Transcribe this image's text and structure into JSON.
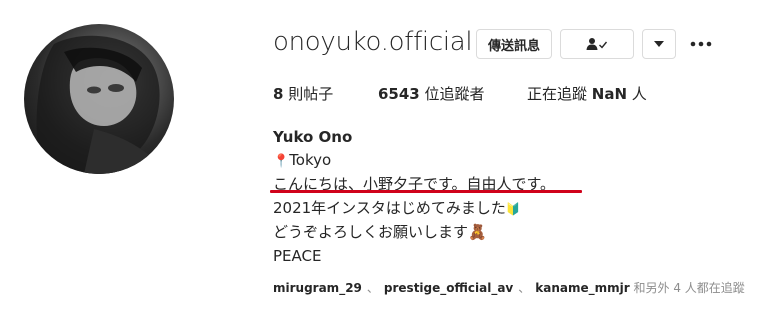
{
  "profile": {
    "username": "onoyuko.official",
    "display_name": "Yuko Ono"
  },
  "actions": {
    "message_label": "傳送訊息",
    "follow_icon": "person-check-icon",
    "dropdown_icon": "caret-down-icon",
    "more_icon": "more-horizontal-icon"
  },
  "stats": {
    "posts_count": "8",
    "posts_label": " 則帖子",
    "followers_count": "6543",
    "followers_label": " 位追蹤者",
    "following_prefix": "正在追蹤 ",
    "following_count": "NaN",
    "following_label": " 人"
  },
  "bio": {
    "location_icon": "📍",
    "location_text": "Tokyo",
    "line2": "こんにちは、小野夕子です。自由人です。",
    "line3": "2021年インスタはじめてみました",
    "line3_emoji": "🔰",
    "line4": "どうぞよろしくお願いします",
    "line4_emoji": "🧸",
    "line5": "PEACE"
  },
  "followed_by": {
    "accounts": [
      "mirugram_29",
      "prestige_official_av",
      "kaname_mmjr"
    ],
    "separator": "、",
    "rest": " 和另外 4 人都在追蹤"
  },
  "colors": {
    "annotation_underline": "#d0021b",
    "text": "#262626",
    "secondary": "#8e8e8e",
    "border": "#dbdbdb"
  }
}
